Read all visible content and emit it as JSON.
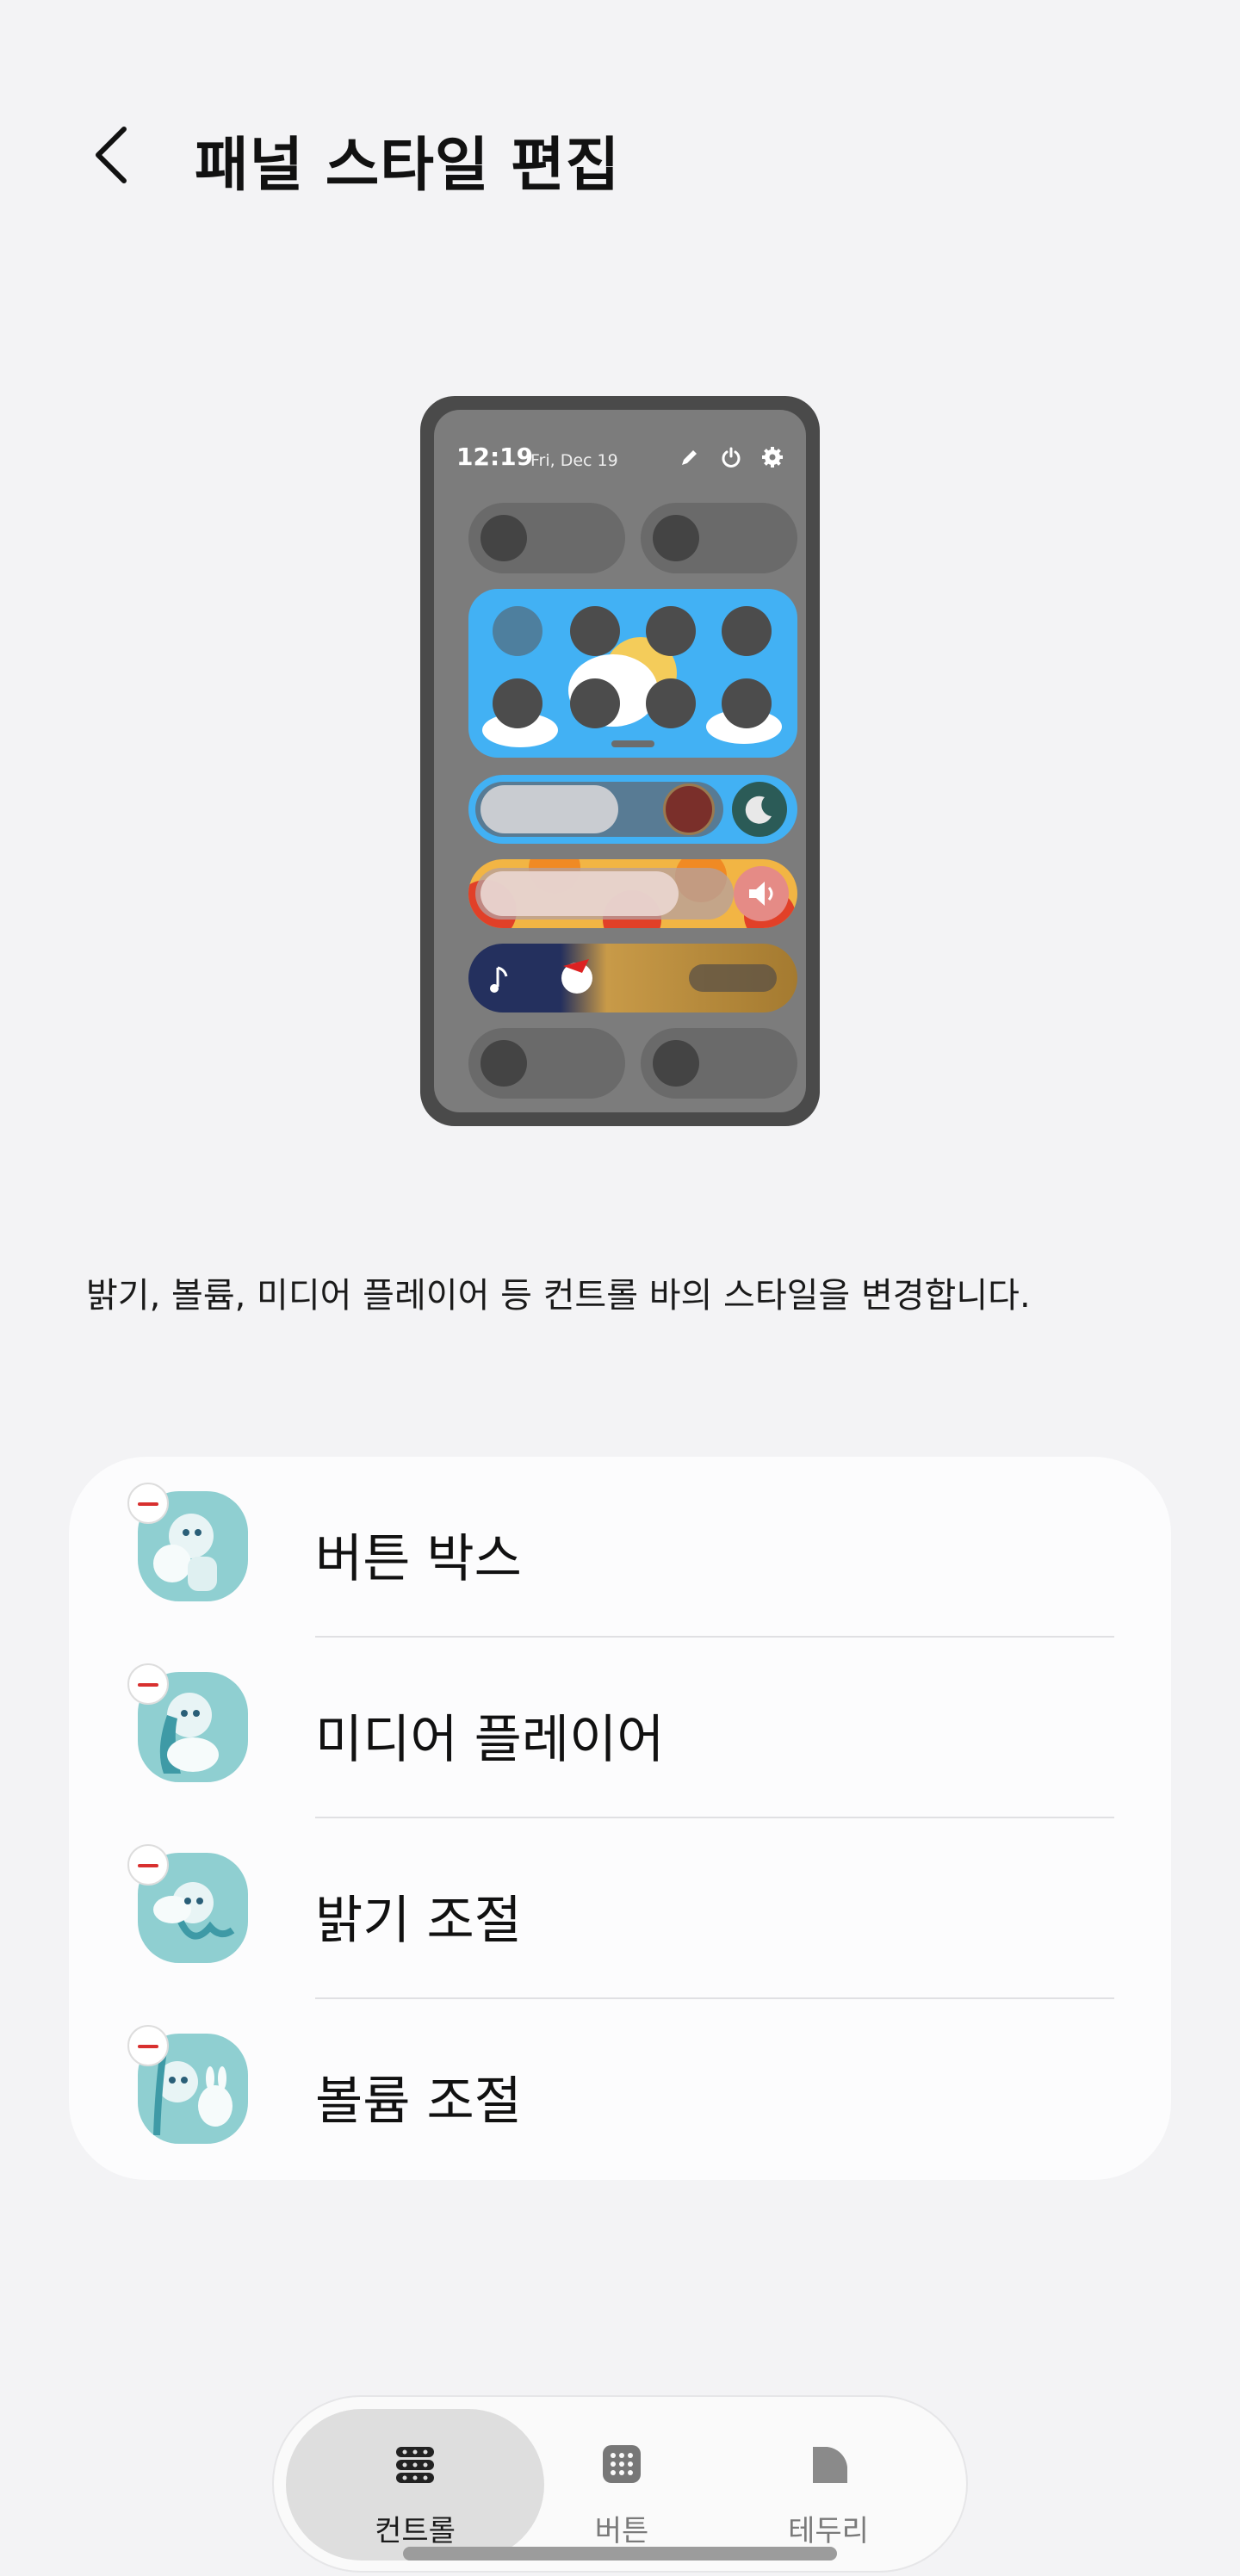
{
  "header": {
    "title": "패널 스타일 편집",
    "back_icon": "chevron-left-icon"
  },
  "preview": {
    "time": "12:19",
    "date": "Fri, Dec 19"
  },
  "description": "밝기, 볼륨, 미디어 플레이어 등 컨트롤 바의 스타일을 변경합니다.",
  "items": [
    {
      "label": "버튼 박스"
    },
    {
      "label": "미디어 플레이어"
    },
    {
      "label": "밝기 조절"
    },
    {
      "label": "볼륨 조절"
    }
  ],
  "nav": [
    {
      "label": "컨트롤",
      "icon": "controls-icon",
      "active": true
    },
    {
      "label": "버튼",
      "icon": "grid-icon",
      "active": false
    },
    {
      "label": "테두리",
      "icon": "corner-icon",
      "active": false
    }
  ],
  "colors": {
    "accent_red": "#d8302f",
    "sky_blue": "#42b1f4",
    "thumb_teal": "#8fcfd1"
  }
}
